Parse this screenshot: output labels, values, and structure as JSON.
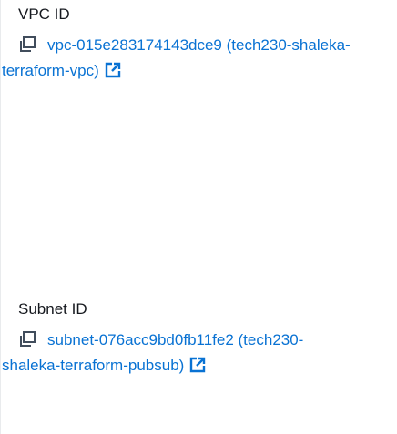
{
  "vpc": {
    "label": "VPC ID",
    "value": "vpc-015e283174143dce9 (tech230-shaleka-terraform-vpc)",
    "copy_icon": "copy-icon",
    "external_icon": "external-link-icon"
  },
  "subnet": {
    "label": "Subnet ID",
    "value": "subnet-076acc9bd0fb11fe2 (tech230-shaleka-terraform-pubsub)",
    "copy_icon": "copy-icon",
    "external_icon": "external-link-icon"
  },
  "colors": {
    "link": "#0972d3",
    "label": "#16191f",
    "icon": "#414d5c",
    "rule": "#e9ebed"
  }
}
